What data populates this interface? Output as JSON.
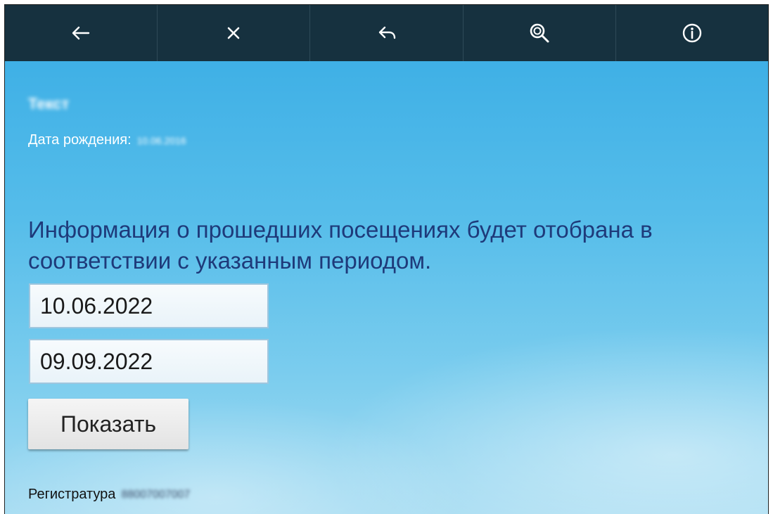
{
  "toolbar": {
    "buttons": [
      {
        "icon": "arrow-left-icon",
        "action": "back"
      },
      {
        "icon": "close-icon",
        "action": "close"
      },
      {
        "icon": "reply-icon",
        "action": "return"
      },
      {
        "icon": "search-icon",
        "action": "search"
      },
      {
        "icon": "info-icon",
        "action": "info"
      }
    ],
    "background": "#16313f"
  },
  "patient": {
    "name": "Текст",
    "dob_label": "Дата рождения:",
    "dob_value": "10.06.2016"
  },
  "visits": {
    "info_text": "Информация о прошедших посещениях будет отобрана в соответствии с указанным периодом.",
    "date_from": "10.06.2022",
    "date_to": "09.09.2022",
    "show_button": "Показать"
  },
  "registry": {
    "label": "Регистратура",
    "value": "88007007007"
  }
}
